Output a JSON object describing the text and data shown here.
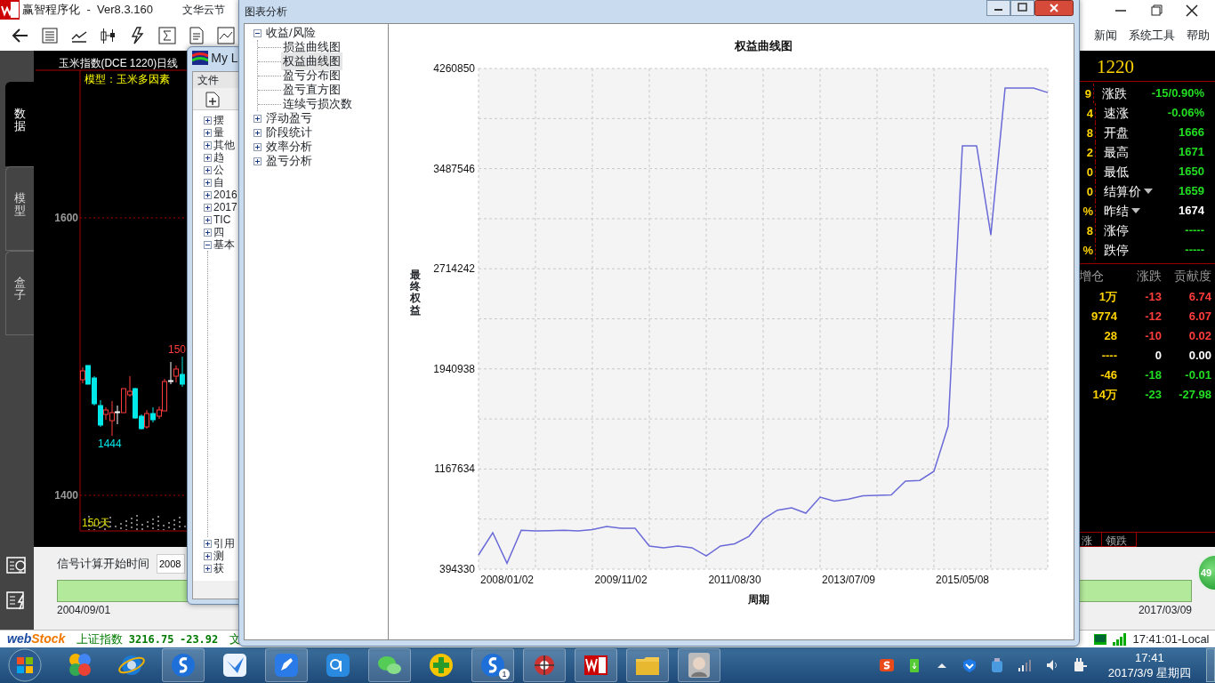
{
  "app": {
    "title": "赢智程序化  -  Ver8.3.160",
    "title_extra": "文华云节",
    "menu": [
      "新闻",
      "系统工具",
      "帮助"
    ]
  },
  "side_tabs": [
    {
      "label": "数据",
      "selected": true
    },
    {
      "label": "模型",
      "selected": false
    },
    {
      "label": "盒子",
      "selected": false
    }
  ],
  "kline": {
    "title": "玉米指数(DCE 1220)日线",
    "model": "模型：玉米多因素",
    "price_labels": [
      "1600",
      "1400"
    ],
    "high_label": "150",
    "low_label": "1444",
    "volume_label": "150天"
  },
  "quote": {
    "symbol": "1220",
    "rows": [
      {
        "side": "9",
        "label": "涨跌",
        "value": "-15/0.90%",
        "color": "#22dd22",
        "dropdown": false
      },
      {
        "side": "4",
        "label": "速涨",
        "value": "-0.06%",
        "color": "#22dd22",
        "dropdown": false
      },
      {
        "side": "8",
        "label": "开盘",
        "value": "1666",
        "color": "#22dd22",
        "dropdown": false
      },
      {
        "side": "2",
        "label": "最高",
        "value": "1671",
        "color": "#22dd22",
        "dropdown": false
      },
      {
        "side": "0",
        "label": "最低",
        "value": "1650",
        "color": "#22dd22",
        "dropdown": false
      },
      {
        "side": "0",
        "label": "结算价",
        "value": "1659",
        "color": "#22dd22",
        "dropdown": true
      },
      {
        "side": "%",
        "label": "昨结",
        "value": "1674",
        "color": "#ffffff",
        "dropdown": true
      },
      {
        "side": "8",
        "label": "涨停",
        "value": "-----",
        "color": "#22dd22",
        "dropdown": false
      },
      {
        "side": "%",
        "label": "跌停",
        "value": "-----",
        "color": "#22dd22",
        "dropdown": false
      }
    ]
  },
  "contrib": {
    "columns": [
      "增仓",
      "涨跌",
      "贡献度"
    ],
    "rows": [
      {
        "cells": [
          "1万",
          "-13",
          "6.74"
        ],
        "color": "#ff3c3c"
      },
      {
        "cells": [
          "9774",
          "-12",
          "6.07"
        ],
        "color": "#ff3c3c"
      },
      {
        "cells": [
          "28",
          "-10",
          "0.02"
        ],
        "color": "#ff3c3c"
      },
      {
        "cells": [
          "----",
          "0",
          "0.00"
        ],
        "color": "#ffffff"
      },
      {
        "cells": [
          "-46",
          "-18",
          "-0.01"
        ],
        "color": "#22dd22"
      },
      {
        "cells": [
          "14万",
          "-23",
          "-27.98"
        ],
        "color": "#22dd22"
      }
    ]
  },
  "bottom_tabs": [
    "涨",
    "领跌"
  ],
  "badge": "49",
  "signal": {
    "label": "信号计算开始时间",
    "value": "2008",
    "level": 1,
    "start_date": "2004/09/01",
    "end_date": "2017/03/09"
  },
  "status_bar": {
    "logo_parts": [
      "web",
      "Stock"
    ],
    "index_name": "上证指数",
    "index_value": "3216.75",
    "index_change": "-23.92",
    "extra": "文",
    "clock": "17:41:01-Local"
  },
  "side_window": {
    "title": "My L",
    "menu": [
      "文件"
    ],
    "tree": [
      {
        "label": "摆",
        "expanded": false
      },
      {
        "label": "量",
        "expanded": false
      },
      {
        "label": "其他",
        "expanded": false
      },
      {
        "label": "趋",
        "expanded": false
      },
      {
        "label": "公",
        "expanded": false
      },
      {
        "label": "自",
        "expanded": false
      },
      {
        "label": "2016",
        "expanded": false
      },
      {
        "label": "2017",
        "expanded": false
      },
      {
        "label": "TIC",
        "expanded": false
      },
      {
        "label": "四",
        "expanded": false
      },
      {
        "label": "基本",
        "expanded": true
      },
      {
        "label": "引用",
        "expanded": false
      },
      {
        "label": "测",
        "expanded": false
      },
      {
        "label": "获",
        "expanded": false
      }
    ]
  },
  "chart_window": {
    "title": "图表分析",
    "tree": [
      {
        "label": "收益/风险",
        "expanded": true,
        "selected": false,
        "children": [
          {
            "label": "损益曲线图",
            "selected": false
          },
          {
            "label": "权益曲线图",
            "selected": true
          },
          {
            "label": "盈亏分布图",
            "selected": false
          },
          {
            "label": "盈亏直方图",
            "selected": false
          },
          {
            "label": "连续亏损次数",
            "selected": false
          }
        ]
      },
      {
        "label": "浮动盈亏",
        "expanded": false,
        "selected": false
      },
      {
        "label": "阶段统计",
        "expanded": false,
        "selected": false
      },
      {
        "label": "效率分析",
        "expanded": false,
        "selected": false
      },
      {
        "label": "盈亏分析",
        "expanded": false,
        "selected": false
      }
    ],
    "chart_data": {
      "type": "line",
      "title": "权益曲线图",
      "xlabel": "周期",
      "ylabel": "最终权益",
      "categories": [
        null,
        null,
        "2008/01/02",
        null,
        null,
        null,
        null,
        null,
        null,
        null,
        "2009/11/02",
        null,
        null,
        null,
        null,
        null,
        null,
        null,
        "2011/08/30",
        null,
        null,
        null,
        null,
        null,
        null,
        null,
        "2013/07/09",
        null,
        null,
        null,
        null,
        null,
        null,
        null,
        "2015/05/08",
        null,
        null,
        null,
        null,
        null,
        null
      ],
      "series": [
        {
          "color": "#6a6ad8",
          "values": [
            504000,
            676000,
            440000,
            695000,
            690000,
            692000,
            695000,
            690000,
            700000,
            724000,
            710000,
            710000,
            573000,
            559000,
            573000,
            560000,
            497000,
            573000,
            590000,
            648000,
            780000,
            850000,
            868000,
            827000,
            950000,
            920000,
            935000,
            960000,
            964000,
            968000,
            1074000,
            1080000,
            1150000,
            1500000,
            3663000,
            3663000,
            2976000,
            4109000,
            4109000,
            4109000,
            4075000
          ]
        }
      ],
      "grid": true,
      "ylim": [
        394330,
        4260850
      ],
      "yticks": [
        394330,
        1167634,
        1940938,
        2714242,
        3487546,
        4260850
      ]
    }
  },
  "taskbar": {
    "time": "17:41",
    "date": "2017/3/9 星期四",
    "badge": "1"
  }
}
